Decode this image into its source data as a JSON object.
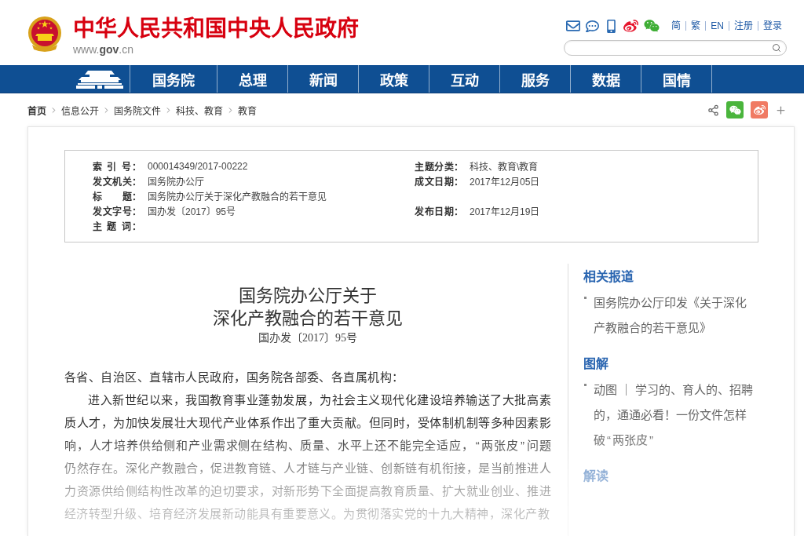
{
  "header": {
    "site_title": "中华人民共和国中央人民政府",
    "site_url": "www.**gov**.cn",
    "top_links": [
      "简",
      "繁",
      "EN",
      "注册",
      "登录"
    ]
  },
  "nav": {
    "items": [
      {
        "label": "国务院",
        "selected": false
      },
      {
        "label": "总理",
        "selected": false
      },
      {
        "label": "新闻",
        "selected": false
      },
      {
        "label": "政策",
        "selected": false
      },
      {
        "label": "互动",
        "selected": false
      },
      {
        "label": "服务",
        "selected": false
      },
      {
        "label": "数据",
        "selected": false
      },
      {
        "label": "国情",
        "selected": false
      }
    ]
  },
  "breadcrumb": [
    "首页",
    "信息公开",
    "国务院文件",
    "科技、教育",
    "教育"
  ],
  "info_table": {
    "rows": [
      [
        {
          "label": "索 引 号：",
          "value": "000014349/2017-00222"
        },
        {
          "label": "主题分类：",
          "value": "科技、教育\\教育"
        }
      ],
      [
        {
          "label": "发文机关：",
          "value": "国务院办公厅"
        },
        {
          "label": "成文日期：",
          "value": "2017年12月05日"
        }
      ],
      [
        {
          "label": "标　　题：",
          "value": "国务院办公厅关于深化产教融合的若干意见"
        }
      ],
      [
        {
          "label": "发文字号：",
          "value": "国办发〔2017〕95号"
        },
        {
          "label": "发布日期：",
          "value": "2017年12月19日"
        }
      ],
      [
        {
          "label": "主 题 词："
        }
      ]
    ]
  },
  "article": {
    "title_lines": [
      "国务院办公厅关于",
      "深化产教融合的若干意见"
    ],
    "doc_number": "国办发〔2017〕95号",
    "salutation": "各省、自治区、直辖市人民政府，国务院各部委、各直属机构：",
    "paragraphs": [
      "进入新世纪以来，我国教育事业蓬勃发展，为社会主义现代化建设培养输送了大批高素质人才，为加快发展壮大现代产业体系作出了重大贡献。但同时，受体制机制等多种因素影响，人才培养供给侧和产业需求侧在结构、质量、水平上还不能完全适应，“两张皮”问题仍然存在。深化产教融合，促进教育链、人才链与产业链、创新链有机衔接，是当前推进人力资源供给侧结构性改革的迫切要求，对新形势下全面提高教育质量、扩大就业创业、推进经济转型升级、培育经济发展新动能具有重要意义。为贯彻落实党的十九大精神，深化产教"
    ]
  },
  "sidebar": {
    "sections": [
      {
        "heading": "相关报道",
        "items": [
          "国务院办公厅印发《关于深化产教融合的若干意见》"
        ]
      },
      {
        "heading": "图解",
        "items": [
          "动图 ｜ 学习的、育人的、招聘的，通通必看！一份文件怎样破“两张皮”"
        ]
      },
      {
        "heading": "解读"
      }
    ]
  }
}
